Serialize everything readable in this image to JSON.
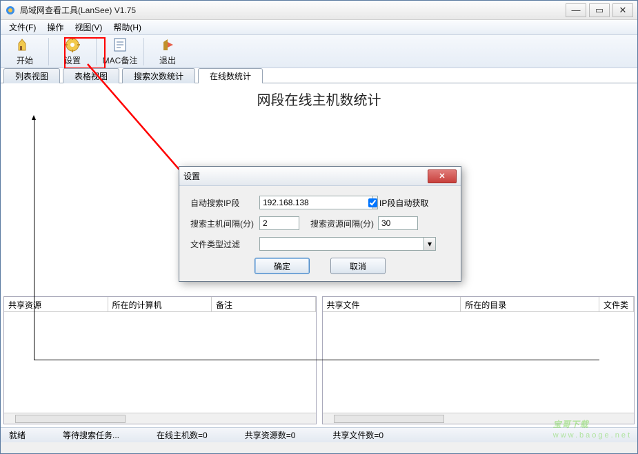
{
  "window": {
    "title": "局域网查看工具(LanSee) V1.75"
  },
  "menu": {
    "file": "文件(F)",
    "operate": "操作",
    "view": "视图(V)",
    "help": "帮助(H)"
  },
  "toolbar": {
    "start": "开始",
    "settings": "设置",
    "mac_remark": "MAC备注",
    "exit": "退出"
  },
  "tabs": {
    "list_view": "列表视图",
    "grid_view": "表格视图",
    "search_stats": "搜索次数统计",
    "online_stats": "在线数统计"
  },
  "chart": {
    "title": "网段在线主机数统计"
  },
  "left_pane": {
    "col1": "共享资源",
    "col2": "所在的计算机",
    "col3": "备注"
  },
  "right_pane": {
    "col1": "共享文件",
    "col2": "所在的目录",
    "col3": "文件类"
  },
  "status": {
    "ready": "就绪",
    "waiting": "等待搜索任务...",
    "online_hosts": "在线主机数=0",
    "shared_res": "共享资源数=0",
    "shared_files": "共享文件数=0"
  },
  "dialog": {
    "title": "设置",
    "auto_search_label": "自动搜索IP段",
    "ip_value": "192.168.138",
    "auto_get_checkbox": "IP段自动获取",
    "host_interval_label": "搜索主机间隔(分)",
    "host_interval_value": "2",
    "res_interval_label": "搜索资源间隔(分)",
    "res_interval_value": "30",
    "file_filter_label": "文件类型过滤",
    "file_filter_value": "",
    "ok": "确定",
    "cancel": "取消"
  },
  "watermark": {
    "main": "宝哥下载",
    "sub": "www.baoge.net"
  }
}
